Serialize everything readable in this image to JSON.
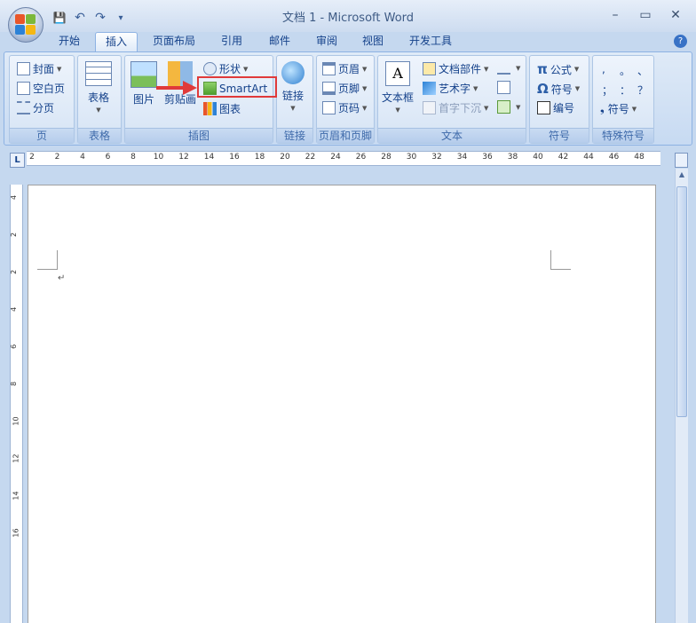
{
  "window": {
    "title": "文档 1 - Microsoft Word",
    "minimize": "–",
    "maximize": "▭",
    "close": "✕"
  },
  "qat": {
    "save": "💾",
    "undo": "↶",
    "redo": "↷",
    "customize": "▾"
  },
  "tabs": [
    {
      "label": "开始"
    },
    {
      "label": "插入",
      "active": true
    },
    {
      "label": "页面布局"
    },
    {
      "label": "引用"
    },
    {
      "label": "邮件"
    },
    {
      "label": "审阅"
    },
    {
      "label": "视图"
    },
    {
      "label": "开发工具"
    }
  ],
  "help": "?",
  "groups": {
    "pages": {
      "label": "页",
      "cover": "封面",
      "blank": "空白页",
      "break": "分页"
    },
    "tables": {
      "label": "表格",
      "table": "表格"
    },
    "illustrations": {
      "label": "插图",
      "picture": "图片",
      "clipart": "剪贴画",
      "shapes": "形状",
      "smartart": "SmartArt",
      "chart": "图表"
    },
    "links": {
      "label": "链接",
      "link": "链接"
    },
    "header_footer": {
      "label": "页眉和页脚",
      "header": "页眉",
      "footer": "页脚",
      "page_number": "页码"
    },
    "text": {
      "label": "文本",
      "textbox": "文本框",
      "quick_parts": "文档部件",
      "wordart": "艺术字",
      "dropcap": "首字下沉"
    },
    "symbols": {
      "label": "符号",
      "equation": "公式",
      "symbol": "符号",
      "numbering": "编号",
      "equation_glyph": "π",
      "symbol_glyph": "Ω"
    },
    "special": {
      "label": "特殊符号",
      "chars": [
        ",",
        "。",
        "、",
        "；",
        "：",
        "？"
      ],
      "more": "符号",
      "more_glyph": "❟"
    }
  },
  "ruler": {
    "tab_marker": "L",
    "h_numbers": [
      "2",
      "2",
      "4",
      "6",
      "8",
      "10",
      "12",
      "14",
      "16",
      "18",
      "20",
      "22",
      "24",
      "26",
      "28",
      "30",
      "32",
      "34",
      "36",
      "38",
      "40",
      "42",
      "44",
      "46",
      "48"
    ],
    "v_numbers": [
      "4",
      "2",
      "2",
      "4",
      "6",
      "8",
      "10",
      "12",
      "14",
      "16"
    ]
  },
  "document": {
    "paragraph_mark": "↵"
  },
  "colors": {
    "accent": "#15428b",
    "highlight": "#e03a3a",
    "ribbon_bg": "#dbe7f6"
  }
}
